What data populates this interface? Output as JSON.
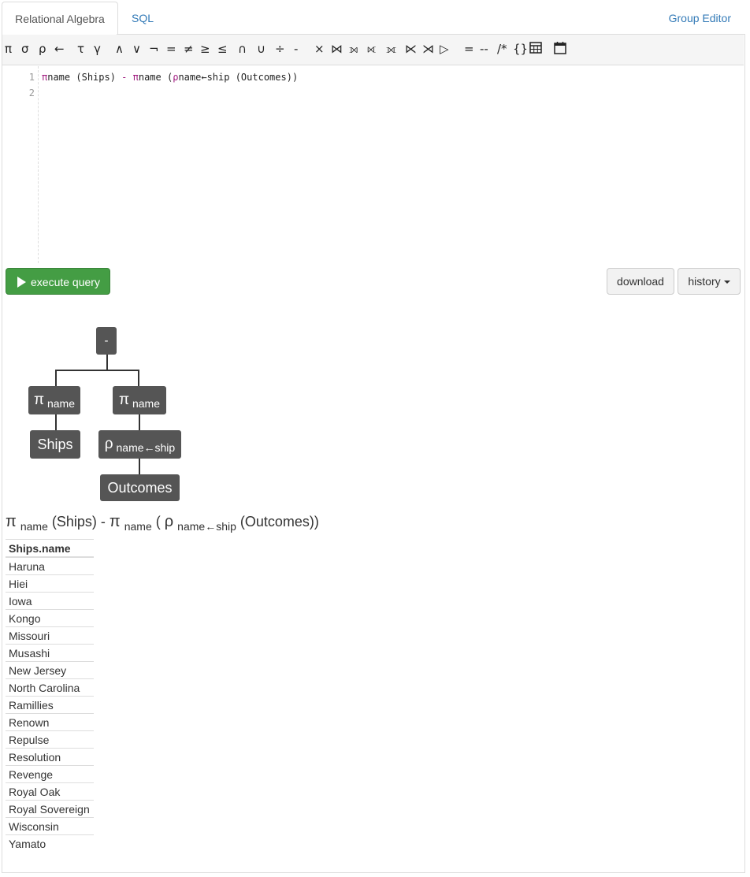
{
  "tabs": {
    "relational_algebra": "Relational Algebra",
    "sql": "SQL",
    "group_editor": "Group Editor"
  },
  "toolbar": [
    {
      "name": "projection-button",
      "label": "π"
    },
    {
      "name": "selection-button",
      "label": "σ"
    },
    {
      "name": "rename-button",
      "label": "ρ"
    },
    {
      "name": "assign-arrow-button",
      "label": "←"
    },
    {
      "name": "orderby-button",
      "label": "τ"
    },
    {
      "name": "groupby-button",
      "label": "γ"
    },
    {
      "name": "and-button",
      "label": "∧"
    },
    {
      "name": "or-button",
      "label": "∨"
    },
    {
      "name": "not-button",
      "label": "¬"
    },
    {
      "name": "equals-button",
      "label": "="
    },
    {
      "name": "not-equal-button",
      "label": "≠"
    },
    {
      "name": "gte-button",
      "label": "≥"
    },
    {
      "name": "lte-button",
      "label": "≤"
    },
    {
      "name": "intersect-button",
      "label": "∩"
    },
    {
      "name": "union-button",
      "label": "∪"
    },
    {
      "name": "division-button",
      "label": "÷"
    },
    {
      "name": "difference-button",
      "label": "-"
    },
    {
      "name": "cross-product-button",
      "label": "×"
    },
    {
      "name": "natural-join-button",
      "label": "⋈"
    },
    {
      "name": "left-outer-join-button",
      "label": "⟕"
    },
    {
      "name": "right-outer-join-button",
      "label": "⟖"
    },
    {
      "name": "full-outer-join-button",
      "label": "⟗"
    },
    {
      "name": "left-semi-join-button",
      "label": "⋉"
    },
    {
      "name": "right-semi-join-button",
      "label": "⋊"
    },
    {
      "name": "anti-join-button",
      "label": "▷"
    },
    {
      "name": "assignment-button",
      "label": "="
    },
    {
      "name": "line-comment-button",
      "label": "--"
    },
    {
      "name": "block-comment-button",
      "label": "/*"
    },
    {
      "name": "braces-button",
      "label": "{}"
    },
    {
      "name": "table-icon",
      "label": "table"
    },
    {
      "name": "calendar-icon",
      "label": "calendar"
    }
  ],
  "editor": {
    "line_numbers": [
      "1",
      "2"
    ],
    "code": {
      "pi1": "π",
      "attr1": "name",
      "rel1": " (Ships) ",
      "minus": "-",
      "pi2": " π",
      "attr2": "name",
      "open": " (",
      "rho": "ρ",
      "rename": "name←ship",
      "rel2": " (Outcomes))"
    }
  },
  "buttons": {
    "execute": "execute query",
    "download": "download",
    "history": "history"
  },
  "tree": {
    "root": "-",
    "left_proj": {
      "sym": "π",
      "sub": "name"
    },
    "right_proj": {
      "sym": "π",
      "sub": "name"
    },
    "left_rel": "Ships",
    "rename": {
      "sym": "ρ",
      "sub": "name←ship"
    },
    "right_rel": "Outcomes"
  },
  "expression": {
    "pi1": "π",
    "sub1": "name",
    "rel1": "(Ships) - ",
    "pi2": "π",
    "sub2": "name",
    "open": "( ",
    "rho": "ρ",
    "sub3": "name←ship",
    "rel2": "(Outcomes))"
  },
  "result": {
    "header": "Ships.name",
    "rows": [
      "Haruna",
      "Hiei",
      "Iowa",
      "Kongo",
      "Missouri",
      "Musashi",
      "New Jersey",
      "North Carolina",
      "Ramillies",
      "Renown",
      "Repulse",
      "Resolution",
      "Revenge",
      "Royal Oak",
      "Royal Sovereign",
      "Wisconsin",
      "Yamato"
    ]
  }
}
